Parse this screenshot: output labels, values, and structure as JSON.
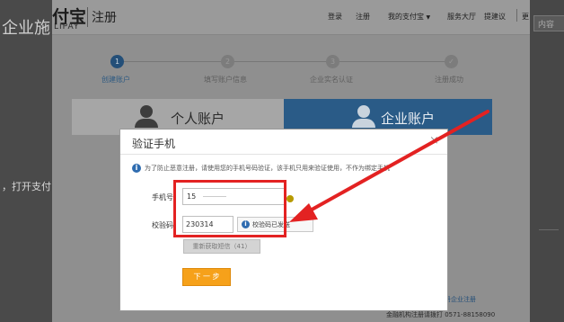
{
  "outer": {
    "left_title": "企业施",
    "left_text": "，打开支付",
    "right_text": "内容"
  },
  "header": {
    "logo_text": "付宝",
    "logo_sub": "LIPAY",
    "page_title": "注册",
    "nav": [
      "登录",
      "注册",
      "我的支付宝",
      "服务大厅",
      "提建议"
    ],
    "right_edge": "更"
  },
  "steps": [
    {
      "num": "1",
      "label": "创建账户"
    },
    {
      "num": "2",
      "label": "填写账户信息"
    },
    {
      "num": "3",
      "label": "企业实名认证"
    },
    {
      "num": "✓",
      "label": "注册成功"
    }
  ],
  "tabs": {
    "personal": "个人账户",
    "enterprise": "企业账户"
  },
  "modal": {
    "title": "验证手机",
    "close": "×",
    "notice": "为了防止恶意注册，请使用您的手机号码验证，该手机只用来验证使用，不作为绑定手机",
    "phone_label": "手机号",
    "phone_value": "15",
    "code_label": "校验码",
    "code_value": "230314",
    "hint": "校验码已发送",
    "resend_label": "重新获取短信（41）",
    "next_label": "下 一 步"
  },
  "footer": {
    "link_text": "册企业注册",
    "hotline": "金融机构注册请拨打 0571-88158090"
  },
  "colors": {
    "enterprise_tab": "#2a5b87",
    "next_button": "#f6a11a",
    "highlight": "#e32222",
    "info_icon": "#2f6cb0"
  }
}
